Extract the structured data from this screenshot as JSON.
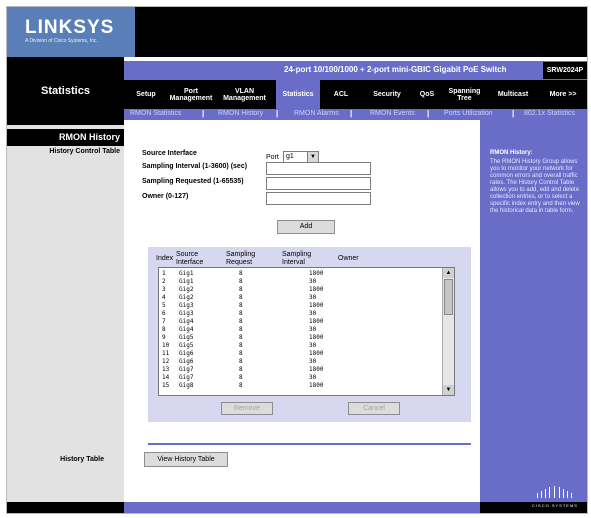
{
  "brand": {
    "logo": "LINKSYS",
    "logo_sub": "A Division of Cisco Systems, Inc."
  },
  "product": {
    "name": "24-port 10/100/1000 + 2-port mini-GBIC Gigabit PoE Switch",
    "model": "SRW2024P"
  },
  "section": {
    "title": "Statistics"
  },
  "tabs": [
    {
      "label": "Setup"
    },
    {
      "label": "Port Management"
    },
    {
      "label": "VLAN Management"
    },
    {
      "label": "Statistics"
    },
    {
      "label": "ACL"
    },
    {
      "label": "Security"
    },
    {
      "label": "QoS"
    },
    {
      "label": "Spanning Tree"
    },
    {
      "label": "Multicast"
    },
    {
      "label": "More >>"
    }
  ],
  "submenu": [
    {
      "label": "RMON Statistics"
    },
    {
      "label": "RMON History"
    },
    {
      "label": "RMON Alarms"
    },
    {
      "label": "RMON Events"
    },
    {
      "label": "Ports Utilization"
    },
    {
      "label": "802.1x Statistics"
    }
  ],
  "submenu_sep": "|",
  "left_nav": {
    "heading": "RMON History",
    "subheading": "History Control Table",
    "history": "History Table"
  },
  "form": {
    "source_interface_label": "Source Interface",
    "port_label": "Port",
    "port_value": "g1",
    "sampling_interval_label": "Sampling Interval (1-3600) (sec)",
    "sampling_requested_label": "Sampling Requested (1-65535)",
    "owner_label": "Owner (0-127)",
    "add_label": "Add"
  },
  "table": {
    "headers": {
      "index": "Index",
      "source": "Source Interface",
      "request": "Sampling Request",
      "interval": "Sampling Interval",
      "owner": "Owner"
    },
    "rows": [
      {
        "index": "1",
        "iface": "Gig1",
        "req": "8",
        "interval": "1800"
      },
      {
        "index": "2",
        "iface": "Gig1",
        "req": "8",
        "interval": "30"
      },
      {
        "index": "3",
        "iface": "Gig2",
        "req": "8",
        "interval": "1800"
      },
      {
        "index": "4",
        "iface": "Gig2",
        "req": "8",
        "interval": "30"
      },
      {
        "index": "5",
        "iface": "Gig3",
        "req": "8",
        "interval": "1800"
      },
      {
        "index": "6",
        "iface": "Gig3",
        "req": "8",
        "interval": "30"
      },
      {
        "index": "7",
        "iface": "Gig4",
        "req": "8",
        "interval": "1800"
      },
      {
        "index": "8",
        "iface": "Gig4",
        "req": "8",
        "interval": "30"
      },
      {
        "index": "9",
        "iface": "Gig5",
        "req": "8",
        "interval": "1800"
      },
      {
        "index": "10",
        "iface": "Gig5",
        "req": "8",
        "interval": "30"
      },
      {
        "index": "11",
        "iface": "Gig6",
        "req": "8",
        "interval": "1800"
      },
      {
        "index": "12",
        "iface": "Gig6",
        "req": "8",
        "interval": "30"
      },
      {
        "index": "13",
        "iface": "Gig7",
        "req": "8",
        "interval": "1800"
      },
      {
        "index": "14",
        "iface": "Gig7",
        "req": "8",
        "interval": "30"
      },
      {
        "index": "15",
        "iface": "Gig8",
        "req": "8",
        "interval": "1800"
      }
    ],
    "remove_label": "Remove",
    "cancel_label": "Cancel"
  },
  "view_history_label": "View History Table",
  "help": {
    "title": "RMON History:",
    "text": "The RMON History Group allows you to monitor your network for common errors and overall traffic rates. The History Control Table allows you to add, edit and delete collection entries, or to select a specific index entry and then view the historical data in table form."
  },
  "footer": {
    "cisco": "CISCO SYSTEMS"
  },
  "colors": {
    "accent": "#6a6dc8",
    "logo_bg": "#5a7fb8",
    "black": "#000000"
  }
}
